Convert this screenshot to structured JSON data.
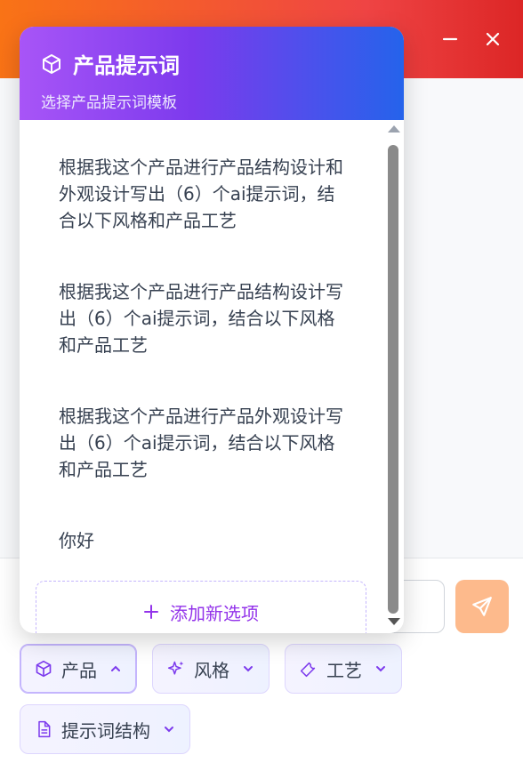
{
  "window": {
    "header_colors": [
      "#f97316",
      "#dc2626"
    ]
  },
  "popup": {
    "title": "产品提示词",
    "subtitle": "选择产品提示词模板",
    "items": [
      "根据我这个产品进行产品结构设计和外观设计写出（6）个ai提示词，结合以下风格和产品工艺",
      "根据我这个产品进行产品结构设计写出（6）个ai提示词，结合以下风格和产品工艺",
      "根据我这个产品进行产品外观设计写出（6）个ai提示词，结合以下风格和产品工艺",
      "你好"
    ],
    "add_label": "添加新选项",
    "icons": {
      "title": "cube-icon",
      "add": "plus-icon"
    }
  },
  "toolbar": {
    "chips": [
      {
        "label": "产品",
        "icon": "cube-icon",
        "active": true
      },
      {
        "label": "风格",
        "icon": "sparkles-icon",
        "active": false
      },
      {
        "label": "工艺",
        "icon": "wrench-icon",
        "active": false
      },
      {
        "label": "提示词结构",
        "icon": "document-icon",
        "active": false
      }
    ]
  },
  "colors": {
    "accent_purple": "#7c3aed",
    "send_button": "#fdba8c"
  }
}
